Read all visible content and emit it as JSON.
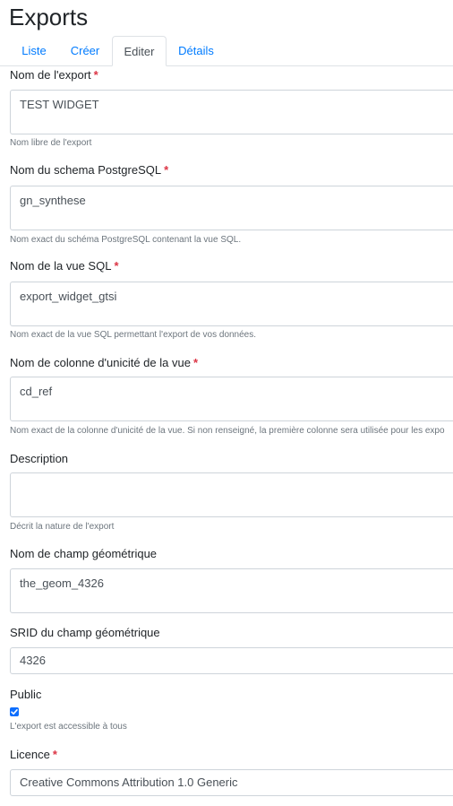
{
  "page": {
    "title": "Exports"
  },
  "tabs": [
    {
      "label": "Liste",
      "active": false
    },
    {
      "label": "Créer",
      "active": false
    },
    {
      "label": "Editer",
      "active": true
    },
    {
      "label": "Détails",
      "active": false
    }
  ],
  "form": {
    "required_marker": "*",
    "nom_export": {
      "label": "Nom de l'export",
      "value": "TEST WIDGET",
      "help": "Nom libre de l'export"
    },
    "schema": {
      "label": "Nom du schema PostgreSQL",
      "value": "gn_synthese",
      "help": "Nom exact du schéma PostgreSQL contenant la vue SQL."
    },
    "vue": {
      "label": "Nom de la vue SQL",
      "value": "export_widget_gtsi",
      "help": "Nom exact de la vue SQL permettant l'export de vos données."
    },
    "colonne": {
      "label": "Nom de colonne d'unicité de la vue",
      "value": "cd_ref",
      "help": "Nom exact de la colonne d'unicité de la vue. Si non renseigné, la première colonne sera utilisée pour les expo"
    },
    "description": {
      "label": "Description",
      "value": "",
      "help": "Décrit la nature de l'export"
    },
    "geom": {
      "label": "Nom de champ géométrique",
      "value": "the_geom_4326"
    },
    "srid": {
      "label": "SRID du champ géométrique",
      "value": "4326"
    },
    "public": {
      "label": "Public",
      "checked": true,
      "help": "L'export est accessible à tous"
    },
    "licence": {
      "label": "Licence",
      "value": "Creative Commons Attribution 1.0 Generic"
    }
  },
  "colors": {
    "link": "#007bff",
    "required": "#dc3545",
    "checkbox": "#0d6efd",
    "help_text": "#6c757d",
    "border": "#ced4da"
  }
}
